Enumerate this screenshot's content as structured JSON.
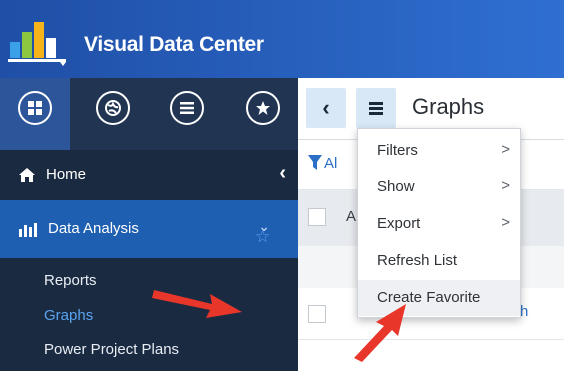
{
  "header": {
    "app_title": "Visual Data Center",
    "logo_icon": "bar-chart-logo-icon"
  },
  "sidebar": {
    "nav_icons": [
      "grid-menu-icon",
      "globe-icon",
      "list-icon",
      "star-icon"
    ],
    "home_label": "Home",
    "home_collapse_icon": "chevron-left-icon",
    "section": {
      "label": "Data Analysis",
      "icon": "bar-chart-icon",
      "expand_icon": "chevron-down-icon",
      "items": [
        {
          "label": "Reports",
          "active": false
        },
        {
          "label": "Graphs",
          "active": true
        },
        {
          "label": "Power Project Plans",
          "active": false
        }
      ]
    },
    "favorite_icon": "star-outline-icon"
  },
  "main": {
    "back_icon": "chevron-left-icon",
    "menu_icon": "hamburger-icon",
    "title": "Graphs",
    "filter_text": "Al",
    "grid_header_text": "A",
    "row_cell_text": "h"
  },
  "dropdown": {
    "items": [
      {
        "label": "Filters",
        "has_submenu": true,
        "submenu_icon": ">"
      },
      {
        "label": "Show",
        "has_submenu": true,
        "submenu_icon": ">"
      },
      {
        "label": "Export",
        "has_submenu": true,
        "submenu_icon": ">"
      },
      {
        "label": "Refresh List",
        "has_submenu": false
      },
      {
        "label": "Create Favorite",
        "has_submenu": false,
        "highlighted": true
      }
    ]
  },
  "colors": {
    "header": "#2a63c4",
    "sidebar": "#1a2a40",
    "active_section": "#1f5fb1",
    "active_link": "#5aa3ef",
    "annotation_arrow": "#e8362b"
  }
}
